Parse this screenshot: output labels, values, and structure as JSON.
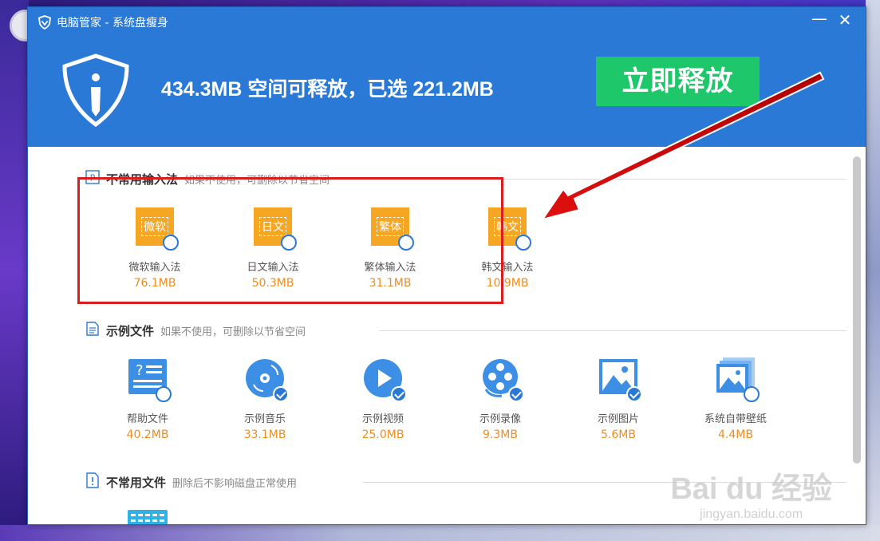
{
  "window": {
    "title": "电脑管家 - 系统盘瘦身",
    "minimize_glyph": "—",
    "close_glyph": "✕"
  },
  "header": {
    "headline": "434.3MB 空间可释放，已选 221.2MB",
    "release_button": "立即释放"
  },
  "sections": {
    "ime": {
      "title": "不常用输入法",
      "desc": "如果不使用，可删除以节省空间",
      "items": [
        {
          "tile": "微软",
          "label": "微软输入法",
          "size": "76.1MB",
          "checked": false
        },
        {
          "tile": "日文",
          "label": "日文输入法",
          "size": "50.3MB",
          "checked": false
        },
        {
          "tile": "繁体",
          "label": "繁体输入法",
          "size": "31.1MB",
          "checked": false
        },
        {
          "tile": "韩文",
          "label": "韩文输入法",
          "size": "10.9MB",
          "checked": false
        }
      ]
    },
    "samples": {
      "title": "示例文件",
      "desc": "如果不使用，可删除以节省空间",
      "items": [
        {
          "icon": "help-file-icon",
          "label": "帮助文件",
          "size": "40.2MB",
          "checked": false
        },
        {
          "icon": "music-disc-icon",
          "label": "示例音乐",
          "size": "33.1MB",
          "checked": true
        },
        {
          "icon": "play-video-icon",
          "label": "示例视频",
          "size": "25.0MB",
          "checked": true
        },
        {
          "icon": "film-reel-icon",
          "label": "示例录像",
          "size": "9.3MB",
          "checked": true
        },
        {
          "icon": "picture-icon",
          "label": "示例图片",
          "size": "5.6MB",
          "checked": true
        },
        {
          "icon": "wallpaper-icon",
          "label": "系统自带壁纸",
          "size": "4.4MB",
          "checked": false
        }
      ]
    },
    "rare": {
      "title": "不常用文件",
      "desc": "删除后不影响磁盘正常使用"
    }
  },
  "watermark": {
    "main": "Bai du 经验",
    "sub": "jingyan.baidu.com"
  },
  "colors": {
    "brand_blue": "#2b79d6",
    "release_green": "#1ec86a",
    "size_orange": "#f08c1e",
    "ime_orange": "#f5a623",
    "annotation_red": "#d81e1e"
  }
}
